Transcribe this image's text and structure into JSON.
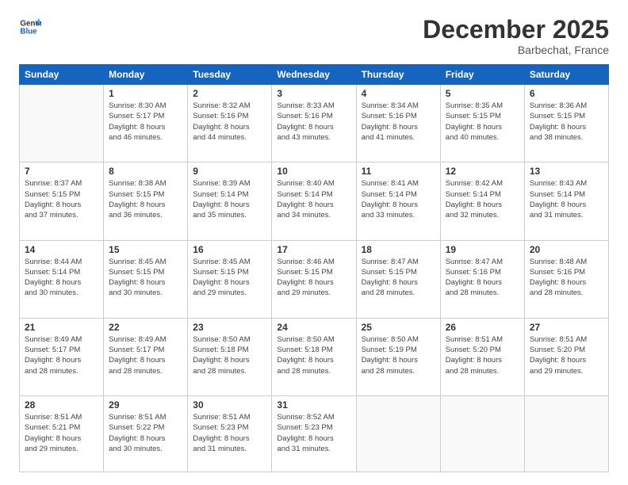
{
  "logo": {
    "line1": "General",
    "line2": "Blue"
  },
  "title": "December 2025",
  "subtitle": "Barbechat, France",
  "headers": [
    "Sunday",
    "Monday",
    "Tuesday",
    "Wednesday",
    "Thursday",
    "Friday",
    "Saturday"
  ],
  "weeks": [
    [
      {
        "day": "",
        "info": ""
      },
      {
        "day": "1",
        "info": "Sunrise: 8:30 AM\nSunset: 5:17 PM\nDaylight: 8 hours\nand 46 minutes."
      },
      {
        "day": "2",
        "info": "Sunrise: 8:32 AM\nSunset: 5:16 PM\nDaylight: 8 hours\nand 44 minutes."
      },
      {
        "day": "3",
        "info": "Sunrise: 8:33 AM\nSunset: 5:16 PM\nDaylight: 8 hours\nand 43 minutes."
      },
      {
        "day": "4",
        "info": "Sunrise: 8:34 AM\nSunset: 5:16 PM\nDaylight: 8 hours\nand 41 minutes."
      },
      {
        "day": "5",
        "info": "Sunrise: 8:35 AM\nSunset: 5:15 PM\nDaylight: 8 hours\nand 40 minutes."
      },
      {
        "day": "6",
        "info": "Sunrise: 8:36 AM\nSunset: 5:15 PM\nDaylight: 8 hours\nand 38 minutes."
      }
    ],
    [
      {
        "day": "7",
        "info": "Sunrise: 8:37 AM\nSunset: 5:15 PM\nDaylight: 8 hours\nand 37 minutes."
      },
      {
        "day": "8",
        "info": "Sunrise: 8:38 AM\nSunset: 5:15 PM\nDaylight: 8 hours\nand 36 minutes."
      },
      {
        "day": "9",
        "info": "Sunrise: 8:39 AM\nSunset: 5:14 PM\nDaylight: 8 hours\nand 35 minutes."
      },
      {
        "day": "10",
        "info": "Sunrise: 8:40 AM\nSunset: 5:14 PM\nDaylight: 8 hours\nand 34 minutes."
      },
      {
        "day": "11",
        "info": "Sunrise: 8:41 AM\nSunset: 5:14 PM\nDaylight: 8 hours\nand 33 minutes."
      },
      {
        "day": "12",
        "info": "Sunrise: 8:42 AM\nSunset: 5:14 PM\nDaylight: 8 hours\nand 32 minutes."
      },
      {
        "day": "13",
        "info": "Sunrise: 8:43 AM\nSunset: 5:14 PM\nDaylight: 8 hours\nand 31 minutes."
      }
    ],
    [
      {
        "day": "14",
        "info": "Sunrise: 8:44 AM\nSunset: 5:14 PM\nDaylight: 8 hours\nand 30 minutes."
      },
      {
        "day": "15",
        "info": "Sunrise: 8:45 AM\nSunset: 5:15 PM\nDaylight: 8 hours\nand 30 minutes."
      },
      {
        "day": "16",
        "info": "Sunrise: 8:45 AM\nSunset: 5:15 PM\nDaylight: 8 hours\nand 29 minutes."
      },
      {
        "day": "17",
        "info": "Sunrise: 8:46 AM\nSunset: 5:15 PM\nDaylight: 8 hours\nand 29 minutes."
      },
      {
        "day": "18",
        "info": "Sunrise: 8:47 AM\nSunset: 5:15 PM\nDaylight: 8 hours\nand 28 minutes."
      },
      {
        "day": "19",
        "info": "Sunrise: 8:47 AM\nSunset: 5:16 PM\nDaylight: 8 hours\nand 28 minutes."
      },
      {
        "day": "20",
        "info": "Sunrise: 8:48 AM\nSunset: 5:16 PM\nDaylight: 8 hours\nand 28 minutes."
      }
    ],
    [
      {
        "day": "21",
        "info": "Sunrise: 8:49 AM\nSunset: 5:17 PM\nDaylight: 8 hours\nand 28 minutes."
      },
      {
        "day": "22",
        "info": "Sunrise: 8:49 AM\nSunset: 5:17 PM\nDaylight: 8 hours\nand 28 minutes."
      },
      {
        "day": "23",
        "info": "Sunrise: 8:50 AM\nSunset: 5:18 PM\nDaylight: 8 hours\nand 28 minutes."
      },
      {
        "day": "24",
        "info": "Sunrise: 8:50 AM\nSunset: 5:18 PM\nDaylight: 8 hours\nand 28 minutes."
      },
      {
        "day": "25",
        "info": "Sunrise: 8:50 AM\nSunset: 5:19 PM\nDaylight: 8 hours\nand 28 minutes."
      },
      {
        "day": "26",
        "info": "Sunrise: 8:51 AM\nSunset: 5:20 PM\nDaylight: 8 hours\nand 28 minutes."
      },
      {
        "day": "27",
        "info": "Sunrise: 8:51 AM\nSunset: 5:20 PM\nDaylight: 8 hours\nand 29 minutes."
      }
    ],
    [
      {
        "day": "28",
        "info": "Sunrise: 8:51 AM\nSunset: 5:21 PM\nDaylight: 8 hours\nand 29 minutes."
      },
      {
        "day": "29",
        "info": "Sunrise: 8:51 AM\nSunset: 5:22 PM\nDaylight: 8 hours\nand 30 minutes."
      },
      {
        "day": "30",
        "info": "Sunrise: 8:51 AM\nSunset: 5:23 PM\nDaylight: 8 hours\nand 31 minutes."
      },
      {
        "day": "31",
        "info": "Sunrise: 8:52 AM\nSunset: 5:23 PM\nDaylight: 8 hours\nand 31 minutes."
      },
      {
        "day": "",
        "info": ""
      },
      {
        "day": "",
        "info": ""
      },
      {
        "day": "",
        "info": ""
      }
    ]
  ]
}
